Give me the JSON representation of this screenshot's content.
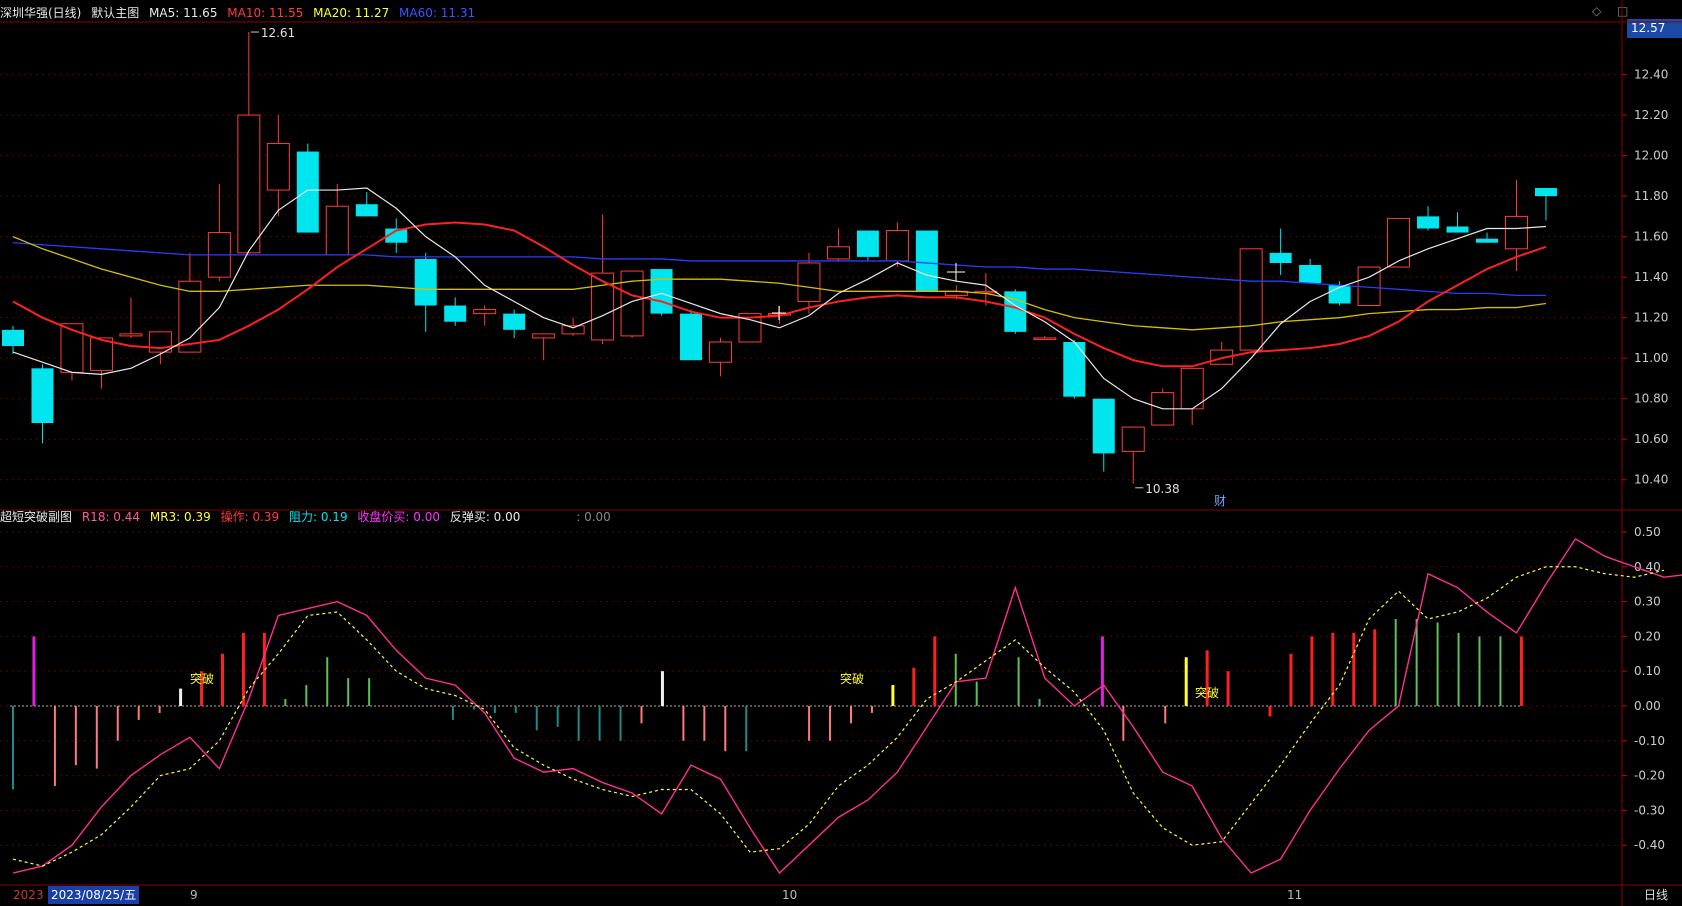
{
  "main_header": {
    "stock": "深圳华强(日线)",
    "chart_name": "默认主图",
    "ma5": "MA5: 11.65",
    "ma10": "MA10: 11.55",
    "ma20": "MA20: 11.27",
    "ma60": "MA60: 11.31"
  },
  "sub_header": {
    "indicator": "超短突破副图",
    "r18": "R18: 0.44",
    "mr3": "MR3: 0.39",
    "op": "操作: 0.39",
    "resist": "阻力: 0.19",
    "close_buy": "收盘价买: 0.00",
    "rebound_buy": "反弹买: 0.00",
    "extra": ": 0.00"
  },
  "current_price": "12.57",
  "corner_icons": [
    "diamond-icon",
    "restore-icon"
  ],
  "corner_glyphs": "◇ □",
  "high_label": "12.61",
  "low_label": "10.38",
  "fin_mark": "财",
  "x_axis": {
    "year_label": "2023",
    "date_cursor": "2023/08/25/五",
    "months": [
      "9",
      "10",
      "11"
    ],
    "period": "日线"
  },
  "breakout_label": "突破",
  "colors": {
    "up": "#ff3b3b",
    "down": "#00e5ee",
    "ma5": "#e8e8e8",
    "ma10": "#ff2020",
    "ma20": "#d4c000",
    "ma60": "#2a3dff",
    "grid": "#5a0000",
    "r18": "#ff2f8f",
    "mr3": "#ffff33"
  },
  "chart_data": [
    {
      "type": "candlestick",
      "title": "深圳华强(日线)",
      "ylim": [
        10.3,
        12.62
      ],
      "y_ticks": [
        "12.40",
        "12.20",
        "12.00",
        "11.80",
        "11.60",
        "11.40",
        "11.20",
        "11.00",
        "10.80",
        "10.60",
        "10.40"
      ],
      "candles": [
        {
          "o": 11.14,
          "h": 11.16,
          "l": 11.02,
          "c": 11.06
        },
        {
          "o": 10.95,
          "h": 10.97,
          "l": 10.58,
          "c": 10.68
        },
        {
          "o": 10.93,
          "h": 11.17,
          "l": 10.89,
          "c": 11.17
        },
        {
          "o": 10.94,
          "h": 11.1,
          "l": 10.85,
          "c": 11.1
        },
        {
          "o": 11.11,
          "h": 11.3,
          "l": 11.1,
          "c": 11.12
        },
        {
          "o": 11.03,
          "h": 11.13,
          "l": 10.97,
          "c": 11.13
        },
        {
          "o": 11.03,
          "h": 11.52,
          "l": 11.03,
          "c": 11.38
        },
        {
          "o": 11.4,
          "h": 11.86,
          "l": 11.38,
          "c": 11.62
        },
        {
          "o": 11.52,
          "h": 12.61,
          "l": 11.52,
          "c": 12.2
        },
        {
          "o": 11.83,
          "h": 12.2,
          "l": 11.7,
          "c": 12.06
        },
        {
          "o": 12.02,
          "h": 12.06,
          "l": 11.62,
          "c": 11.62
        },
        {
          "o": 11.51,
          "h": 11.86,
          "l": 11.51,
          "c": 11.75
        },
        {
          "o": 11.76,
          "h": 11.82,
          "l": 11.7,
          "c": 11.7
        },
        {
          "o": 11.64,
          "h": 11.69,
          "l": 11.52,
          "c": 11.57
        },
        {
          "o": 11.49,
          "h": 11.52,
          "l": 11.13,
          "c": 11.26
        },
        {
          "o": 11.26,
          "h": 11.3,
          "l": 11.16,
          "c": 11.18
        },
        {
          "o": 11.22,
          "h": 11.26,
          "l": 11.16,
          "c": 11.24
        },
        {
          "o": 11.22,
          "h": 11.24,
          "l": 11.1,
          "c": 11.14
        },
        {
          "o": 11.1,
          "h": 11.12,
          "l": 10.99,
          "c": 11.12
        },
        {
          "o": 11.12,
          "h": 11.2,
          "l": 11.11,
          "c": 11.16
        },
        {
          "o": 11.09,
          "h": 11.71,
          "l": 11.07,
          "c": 11.42
        },
        {
          "o": 11.11,
          "h": 11.43,
          "l": 11.1,
          "c": 11.43
        },
        {
          "o": 11.44,
          "h": 11.44,
          "l": 11.21,
          "c": 11.22
        },
        {
          "o": 11.22,
          "h": 11.24,
          "l": 10.99,
          "c": 10.99
        },
        {
          "o": 10.98,
          "h": 11.1,
          "l": 10.91,
          "c": 11.08
        },
        {
          "o": 11.08,
          "h": 11.22,
          "l": 11.08,
          "c": 11.22
        },
        {
          "o": 11.22,
          "h": 11.26,
          "l": 11.17,
          "c": 11.22
        },
        {
          "o": 11.28,
          "h": 11.52,
          "l": 11.22,
          "c": 11.47
        },
        {
          "o": 11.49,
          "h": 11.64,
          "l": 11.48,
          "c": 11.55
        },
        {
          "o": 11.63,
          "h": 11.63,
          "l": 11.48,
          "c": 11.5
        },
        {
          "o": 11.48,
          "h": 11.67,
          "l": 11.45,
          "c": 11.63
        },
        {
          "o": 11.63,
          "h": 11.63,
          "l": 11.33,
          "c": 11.33
        },
        {
          "o": 11.31,
          "h": 11.36,
          "l": 11.29,
          "c": 11.33
        },
        {
          "o": 11.33,
          "h": 11.42,
          "l": 11.26,
          "c": 11.33
        },
        {
          "o": 11.33,
          "h": 11.34,
          "l": 11.12,
          "c": 11.13
        },
        {
          "o": 11.1,
          "h": 11.11,
          "l": 11.09,
          "c": 11.1
        },
        {
          "o": 11.08,
          "h": 11.09,
          "l": 10.8,
          "c": 10.81
        },
        {
          "o": 10.8,
          "h": 10.8,
          "l": 10.44,
          "c": 10.53
        },
        {
          "o": 10.54,
          "h": 10.66,
          "l": 10.38,
          "c": 10.66
        },
        {
          "o": 10.67,
          "h": 10.85,
          "l": 10.67,
          "c": 10.83
        },
        {
          "o": 10.75,
          "h": 10.95,
          "l": 10.67,
          "c": 10.95
        },
        {
          "o": 10.97,
          "h": 11.08,
          "l": 10.97,
          "c": 11.04
        },
        {
          "o": 11.04,
          "h": 11.54,
          "l": 11.04,
          "c": 11.54
        },
        {
          "o": 11.52,
          "h": 11.64,
          "l": 11.41,
          "c": 11.47
        },
        {
          "o": 11.46,
          "h": 11.49,
          "l": 11.37,
          "c": 11.37
        },
        {
          "o": 11.36,
          "h": 11.38,
          "l": 11.26,
          "c": 11.27
        },
        {
          "o": 11.26,
          "h": 11.45,
          "l": 11.26,
          "c": 11.45
        },
        {
          "o": 11.45,
          "h": 11.69,
          "l": 11.45,
          "c": 11.69
        },
        {
          "o": 11.7,
          "h": 11.75,
          "l": 11.63,
          "c": 11.64
        },
        {
          "o": 11.65,
          "h": 11.72,
          "l": 11.62,
          "c": 11.62
        },
        {
          "o": 11.59,
          "h": 11.62,
          "l": 11.57,
          "c": 11.57
        },
        {
          "o": 11.54,
          "h": 11.88,
          "l": 11.43,
          "c": 11.7
        },
        {
          "o": 11.84,
          "h": 11.84,
          "l": 11.68,
          "c": 11.8
        }
      ],
      "ma5": [
        11.03,
        10.98,
        10.93,
        10.92,
        10.95,
        11.02,
        11.1,
        11.25,
        11.53,
        11.73,
        11.83,
        11.83,
        11.84,
        11.74,
        11.6,
        11.5,
        11.36,
        11.28,
        11.2,
        11.15,
        11.21,
        11.28,
        11.32,
        11.27,
        11.22,
        11.19,
        11.15,
        11.21,
        11.32,
        11.39,
        11.47,
        11.41,
        11.38,
        11.36,
        11.26,
        11.18,
        11.08,
        10.9,
        10.8,
        10.75,
        10.75,
        10.85,
        11.0,
        11.17,
        11.28,
        11.35,
        11.4,
        11.48,
        11.54,
        11.59,
        11.64,
        11.64,
        11.65
      ],
      "ma10": [
        11.28,
        11.2,
        11.14,
        11.09,
        11.06,
        11.05,
        11.07,
        11.09,
        11.16,
        11.24,
        11.34,
        11.45,
        11.54,
        11.63,
        11.66,
        11.67,
        11.66,
        11.63,
        11.55,
        11.46,
        11.38,
        11.31,
        11.28,
        11.23,
        11.2,
        11.2,
        11.21,
        11.25,
        11.28,
        11.3,
        11.31,
        11.3,
        11.3,
        11.28,
        11.25,
        11.2,
        11.12,
        11.05,
        10.99,
        10.96,
        10.96,
        11.0,
        11.03,
        11.04,
        11.05,
        11.07,
        11.11,
        11.18,
        11.28,
        11.36,
        11.44,
        11.5,
        11.55
      ],
      "ma20": [
        11.6,
        11.54,
        11.49,
        11.44,
        11.4,
        11.36,
        11.33,
        11.33,
        11.34,
        11.35,
        11.36,
        11.36,
        11.36,
        11.35,
        11.34,
        11.34,
        11.34,
        11.34,
        11.34,
        11.34,
        11.36,
        11.38,
        11.39,
        11.39,
        11.39,
        11.38,
        11.37,
        11.35,
        11.33,
        11.33,
        11.33,
        11.33,
        11.33,
        11.32,
        11.29,
        11.24,
        11.2,
        11.18,
        11.16,
        11.15,
        11.14,
        11.15,
        11.16,
        11.18,
        11.19,
        11.2,
        11.22,
        11.23,
        11.24,
        11.24,
        11.25,
        11.25,
        11.27
      ],
      "ma60": [
        11.57,
        11.56,
        11.55,
        11.54,
        11.53,
        11.52,
        11.51,
        11.51,
        11.51,
        11.51,
        11.51,
        11.51,
        11.51,
        11.5,
        11.5,
        11.5,
        11.5,
        11.5,
        11.5,
        11.5,
        11.49,
        11.49,
        11.49,
        11.48,
        11.48,
        11.48,
        11.48,
        11.48,
        11.48,
        11.48,
        11.48,
        11.47,
        11.46,
        11.45,
        11.45,
        11.44,
        11.44,
        11.43,
        11.42,
        11.41,
        11.4,
        11.39,
        11.38,
        11.38,
        11.37,
        11.36,
        11.35,
        11.34,
        11.33,
        11.32,
        11.32,
        11.31,
        11.31
      ]
    },
    {
      "type": "bar",
      "title": "超短突破副图",
      "ylim": [
        -0.5,
        0.52
      ],
      "y_ticks": [
        "0.50",
        "0.40",
        "0.30",
        "0.20",
        "0.10",
        "0.00",
        "-0.10",
        "-0.20",
        "-0.30",
        "-0.40"
      ],
      "bars": [
        -0.24,
        0.2,
        -0.23,
        -0.17,
        -0.18,
        -0.1,
        -0.04,
        -0.02,
        0.05,
        0.1,
        0.15,
        0.21,
        0.21,
        0.02,
        0.06,
        0.14,
        0.08,
        0.08,
        0.0,
        0.0,
        0.0,
        -0.04,
        -0.01,
        -0.02,
        -0.02,
        -0.07,
        -0.06,
        -0.1,
        -0.1,
        -0.1,
        -0.05,
        0.1,
        -0.1,
        -0.1,
        -0.13,
        -0.13,
        0.0,
        0.0,
        -0.1,
        -0.1,
        -0.05,
        -0.02,
        0.06,
        0.11,
        0.2,
        0.15,
        0.07,
        0.0,
        0.14,
        0.02,
        0.0,
        0.0,
        0.2,
        -0.1,
        0.0,
        -0.05,
        0.14,
        0.16,
        0.1,
        0.0,
        -0.03,
        0.15,
        0.2,
        0.21,
        0.21,
        0.22,
        0.25,
        0.25,
        0.24,
        0.21,
        0.2,
        0.2,
        0.2
      ],
      "bar_colors": [
        "#1a8a8a",
        "#e020e0",
        "#ff7a7a",
        "#ff7a7a",
        "#ff7a7a",
        "#ff7a7a",
        "#ff7a7a",
        "#ff7a7a",
        "#f0f0f0",
        "#ff2020",
        "#ff2020",
        "#ff2020",
        "#ff2020",
        "#5fbf5f",
        "#5fbf5f",
        "#5fbf5f",
        "#5fbf5f",
        "#5fbf5f",
        "#1a8a8a",
        "#1a8a8a",
        "#1a8a8a",
        "#1a8a8a",
        "#1a8a8a",
        "#1a8a8a",
        "#1a8a8a",
        "#1a8a8a",
        "#1a8a8a",
        "#1a8a8a",
        "#1a8a8a",
        "#1a8a8a",
        "#ff7a7a",
        "#f0f0f0",
        "#ff7a7a",
        "#ff7a7a",
        "#ff7a7a",
        "#1a8a8a",
        "#1a8a8a",
        "#1a8a8a",
        "#ff7a7a",
        "#ff7a7a",
        "#ff7a7a",
        "#ff7a7a",
        "#ffff33",
        "#ff2020",
        "#ff2020",
        "#5fbf5f",
        "#5fbf5f",
        "#5fbf5f",
        "#5fbf5f",
        "#5fbf5f",
        "#1a8a8a",
        "#1a8a8a",
        "#e020e0",
        "#ff7a7a",
        "#ff7a7a",
        "#ff7a7a",
        "#ffff33",
        "#ff2020",
        "#ff2020",
        "#ff2020",
        "#ff2020",
        "#ff2020",
        "#ff2020",
        "#ff2020",
        "#ff2020",
        "#ff2020",
        "#5fbf5f",
        "#5fbf5f",
        "#5fbf5f",
        "#5fbf5f",
        "#5fbf5f",
        "#5fbf5f",
        "#ff2020"
      ],
      "r18": [
        -0.48,
        -0.46,
        -0.4,
        -0.29,
        -0.2,
        -0.14,
        -0.09,
        -0.18,
        0.02,
        0.26,
        0.28,
        0.3,
        0.26,
        0.16,
        0.08,
        0.06,
        -0.02,
        -0.15,
        -0.19,
        -0.18,
        -0.22,
        -0.25,
        -0.31,
        -0.17,
        -0.21,
        -0.35,
        -0.48,
        -0.4,
        -0.32,
        -0.27,
        -0.19,
        -0.06,
        0.07,
        0.08,
        0.34,
        0.08,
        0.0,
        0.06,
        -0.06,
        -0.19,
        -0.23,
        -0.38,
        -0.48,
        -0.44,
        -0.3,
        -0.18,
        -0.07,
        0.0,
        0.38,
        0.34,
        0.27,
        0.21,
        0.35,
        0.48,
        0.43,
        0.4,
        0.37,
        0.38,
        0.44
      ],
      "mr3": [
        -0.44,
        -0.46,
        -0.42,
        -0.37,
        -0.29,
        -0.2,
        -0.18,
        -0.1,
        0.05,
        0.15,
        0.26,
        0.27,
        0.19,
        0.1,
        0.05,
        0.03,
        -0.01,
        -0.12,
        -0.17,
        -0.21,
        -0.24,
        -0.26,
        -0.24,
        -0.24,
        -0.31,
        -0.42,
        -0.41,
        -0.34,
        -0.23,
        -0.17,
        -0.09,
        0.02,
        0.07,
        0.13,
        0.19,
        0.11,
        0.04,
        -0.07,
        -0.25,
        -0.35,
        -0.4,
        -0.39,
        -0.28,
        -0.17,
        -0.05,
        0.06,
        0.25,
        0.33,
        0.25,
        0.27,
        0.31,
        0.37,
        0.4,
        0.4,
        0.38,
        0.37,
        0.39
      ]
    }
  ]
}
